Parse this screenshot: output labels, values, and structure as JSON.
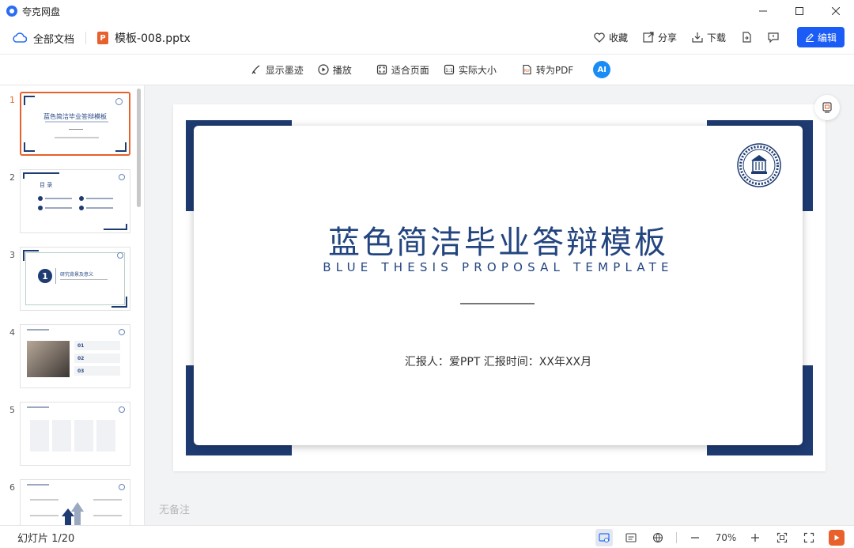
{
  "titlebar": {
    "app_name": "夸克网盘",
    "controls": [
      "minimize",
      "maximize",
      "close"
    ]
  },
  "toolbar": {
    "all_docs": "全部文档",
    "file_badge": "P",
    "file_name": "模板-008.pptx",
    "favorite": "收藏",
    "share": "分享",
    "download": "下载",
    "edit": "编辑"
  },
  "viewbar": {
    "ink": "显示墨迹",
    "play": "播放",
    "fit_page": "适合页面",
    "actual_size": "实际大小",
    "to_pdf": "转为PDF",
    "ai_label": "AI"
  },
  "thumbnails": [
    {
      "number": "1",
      "active": true
    },
    {
      "number": "2",
      "active": false
    },
    {
      "number": "3",
      "active": false
    },
    {
      "number": "4",
      "active": false
    },
    {
      "number": "5",
      "active": false
    },
    {
      "number": "6",
      "active": false
    }
  ],
  "thumb_text": {
    "t1_title": "蓝色简洁毕业答辩模板",
    "t2_heading": "目 录",
    "t3_number": "1",
    "t3_heading": "研究背景及意义",
    "t4_n1": "01",
    "t4_n2": "02",
    "t4_n3": "03"
  },
  "slide": {
    "title": "蓝色简洁毕业答辩模板",
    "subtitle": "BLUE THESIS PROPOSAL TEMPLATE",
    "reporter": "汇报人：爱PPT   汇报时间：XX年XX月",
    "accent": "#1e3b72"
  },
  "notes_placeholder": "无备注",
  "status": {
    "slide_count": "幻灯片 1/20",
    "zoom": "70%"
  },
  "colors": {
    "brand_blue": "#1a5cf5",
    "active_orange": "#e8612c",
    "slide_navy": "#1e3b72"
  }
}
